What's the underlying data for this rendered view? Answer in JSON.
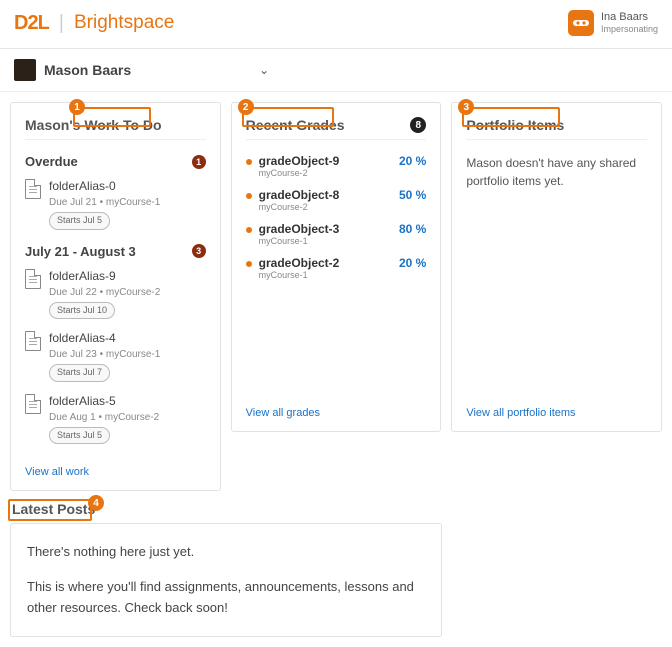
{
  "header": {
    "logo": "D2L",
    "product": "Brightspace",
    "user_name": "Ina Baars",
    "user_status": "Impersonating"
  },
  "context": {
    "name": "Mason Baars"
  },
  "work": {
    "title": "Mason's Work To Do",
    "sections": [
      {
        "label": "Overdue",
        "count": "1",
        "items": [
          {
            "title": "folderAlias-0",
            "meta": "Due Jul 21 • myCourse-1",
            "pill": "Starts Jul 5"
          }
        ]
      },
      {
        "label": "July 21 - August 3",
        "count": "3",
        "items": [
          {
            "title": "folderAlias-9",
            "meta": "Due Jul 22 • myCourse-2",
            "pill": "Starts Jul 10"
          },
          {
            "title": "folderAlias-4",
            "meta": "Due Jul 23 • myCourse-1",
            "pill": "Starts Jul 7"
          },
          {
            "title": "folderAlias-5",
            "meta": "Due Aug 1 • myCourse-2",
            "pill": "Starts Jul 5"
          }
        ]
      }
    ],
    "link": "View all work"
  },
  "grades": {
    "title": "Recent Grades",
    "count": "8",
    "rows": [
      {
        "name": "gradeObject-9",
        "course": "myCourse-2",
        "pct": "20 %"
      },
      {
        "name": "gradeObject-8",
        "course": "myCourse-2",
        "pct": "50 %"
      },
      {
        "name": "gradeObject-3",
        "course": "myCourse-1",
        "pct": "80 %"
      },
      {
        "name": "gradeObject-2",
        "course": "myCourse-1",
        "pct": "20 %"
      }
    ],
    "link": "View all grades"
  },
  "portfolio": {
    "title": "Portfolio Items",
    "empty": "Mason doesn't have any shared portfolio items yet.",
    "link": "View all portfolio items"
  },
  "latest": {
    "title": "Latest Posts",
    "empty_head": "There's nothing here just yet.",
    "empty_body": "This is where you'll find assignments, announcements, lessons and other resources. Check back soon!"
  },
  "annotations": {
    "a1": "1",
    "a2": "2",
    "a3": "3",
    "a4": "4"
  }
}
